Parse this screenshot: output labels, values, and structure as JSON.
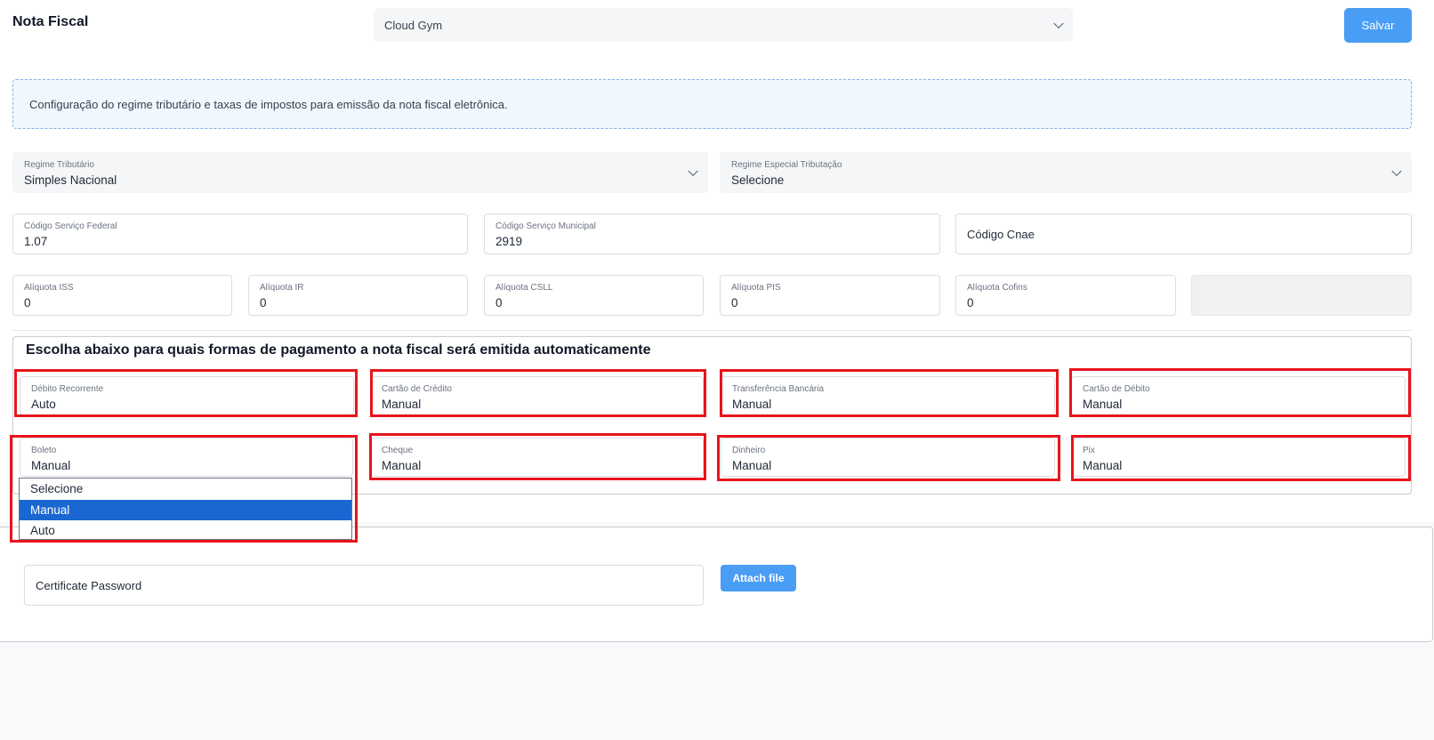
{
  "header": {
    "title": "Nota Fiscal",
    "company_select": "Cloud Gym",
    "save_label": "Salvar"
  },
  "info_banner": "Configuração do regime tributário e taxas de impostos para emissão da nota fiscal eletrônica.",
  "tax_regime": {
    "regime_tributario": {
      "label": "Regime Tributário",
      "value": "Simples Nacional"
    },
    "regime_especial": {
      "label": "Regime Especial Tributação",
      "value": "Selecione"
    }
  },
  "service_codes": {
    "federal": {
      "label": "Código Serviço Federal",
      "value": "1.07"
    },
    "municipal": {
      "label": "Código Serviço Municipal",
      "value": "2919"
    },
    "cnae": {
      "placeholder": "Código Cnae"
    }
  },
  "rates": {
    "iss": {
      "label": "Alíquota ISS",
      "value": "0"
    },
    "ir": {
      "label": "Alíquota IR",
      "value": "0"
    },
    "csll": {
      "label": "Alíquota CSLL",
      "value": "0"
    },
    "pis": {
      "label": "Alíquota PIS",
      "value": "0"
    },
    "cofins": {
      "label": "Alíquota Cofins",
      "value": "0"
    }
  },
  "payments": {
    "title": "Escolha abaixo para quais formas de pagamento a nota fiscal será emitida automaticamente",
    "debito_recorrente": {
      "label": "Débito Recorrente",
      "value": "Auto"
    },
    "cartao_credito": {
      "label": "Cartão de Crédito",
      "value": "Manual"
    },
    "transferencia": {
      "label": "Transferência Bancária",
      "value": "Manual"
    },
    "cartao_debito": {
      "label": "Cartão de Débito",
      "value": "Manual"
    },
    "boleto": {
      "label": "Boleto",
      "value": "Manual"
    },
    "cheque": {
      "label": "Cheque",
      "value": "Manual"
    },
    "dinheiro": {
      "label": "Dinheiro",
      "value": "Manual"
    },
    "pix": {
      "label": "Pix",
      "value": "Manual"
    }
  },
  "boleto_dropdown": {
    "options": [
      "Selecione",
      "Manual",
      "Auto"
    ],
    "selected": "Manual"
  },
  "certificate": {
    "password_placeholder": "Certificate Password",
    "attach_label": "Attach file"
  },
  "colors": {
    "primary_button": "#4a9df5",
    "highlight_outline": "#e8141c",
    "dropdown_selected": "#1a67d2"
  }
}
